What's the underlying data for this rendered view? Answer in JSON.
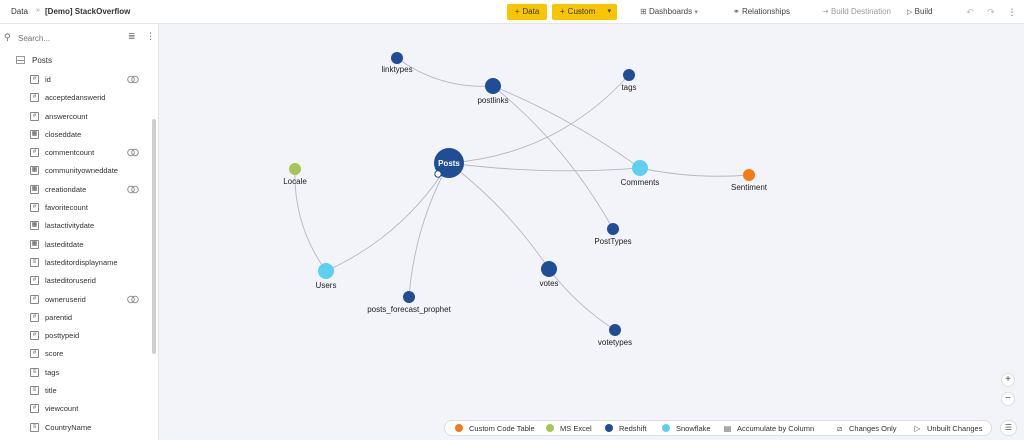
{
  "topbar": {
    "breadcrumb_root": "Data",
    "breadcrumb_sep": "»",
    "project": "[Demo] StackOverflow",
    "data_button": "Data",
    "custom_button": "Custom",
    "dashboards": "Dashboards",
    "relationships": "Relationships",
    "build_destination": "Build Destination",
    "build": "Build",
    "accent_color": "#f7c600"
  },
  "sidebar": {
    "search_placeholder": "Search...",
    "root_table": "Posts",
    "fields": [
      {
        "name": "id",
        "type": "#",
        "linked": true
      },
      {
        "name": "acceptedanswerid",
        "type": "#",
        "linked": false
      },
      {
        "name": "answercount",
        "type": "#",
        "linked": false
      },
      {
        "name": "closeddate",
        "type": "date",
        "linked": false
      },
      {
        "name": "commentcount",
        "type": "#",
        "linked": true
      },
      {
        "name": "communityowneddate",
        "type": "date",
        "linked": false
      },
      {
        "name": "creationdate",
        "type": "date",
        "linked": true
      },
      {
        "name": "favoritecount",
        "type": "#",
        "linked": false
      },
      {
        "name": "lastactivitydate",
        "type": "date",
        "linked": false
      },
      {
        "name": "lasteditdate",
        "type": "date",
        "linked": false
      },
      {
        "name": "lasteditordisplayname",
        "type": "text",
        "linked": false
      },
      {
        "name": "lasteditoruserid",
        "type": "#",
        "linked": false
      },
      {
        "name": "owneruserid",
        "type": "#",
        "linked": true
      },
      {
        "name": "parentid",
        "type": "#",
        "linked": false
      },
      {
        "name": "posttypeid",
        "type": "#",
        "linked": false
      },
      {
        "name": "score",
        "type": "#",
        "linked": false
      },
      {
        "name": "tags",
        "type": "text",
        "linked": false
      },
      {
        "name": "title",
        "type": "text",
        "linked": false
      },
      {
        "name": "viewcount",
        "type": "#",
        "linked": false
      },
      {
        "name": "CountryName",
        "type": "text",
        "linked": false
      }
    ]
  },
  "graph": {
    "colors": {
      "redshift": "#1f4e96",
      "snowflake": "#5bd0f0",
      "msexcel": "#a8c455",
      "custom": "#f47b16",
      "edge": "#b7b7c4"
    },
    "nodes": [
      {
        "id": "Posts",
        "label": "Posts",
        "source": "redshift"
      },
      {
        "id": "linktypes",
        "label": "linktypes",
        "source": "redshift"
      },
      {
        "id": "postlinks",
        "label": "postlinks",
        "source": "redshift"
      },
      {
        "id": "tags",
        "label": "tags",
        "source": "redshift"
      },
      {
        "id": "Locale",
        "label": "Locale",
        "source": "msexcel"
      },
      {
        "id": "Comments",
        "label": "Comments",
        "source": "snowflake"
      },
      {
        "id": "Sentiment",
        "label": "Sentiment",
        "source": "custom"
      },
      {
        "id": "PostTypes",
        "label": "PostTypes",
        "source": "redshift"
      },
      {
        "id": "Users",
        "label": "Users",
        "source": "snowflake"
      },
      {
        "id": "votes",
        "label": "votes",
        "source": "redshift"
      },
      {
        "id": "posts_forecast_prophet",
        "label": "posts_forecast_prophet",
        "source": "redshift"
      },
      {
        "id": "votetypes",
        "label": "votetypes",
        "source": "redshift"
      }
    ],
    "edges": [
      [
        "linktypes",
        "postlinks"
      ],
      [
        "postlinks",
        "Comments"
      ],
      [
        "postlinks",
        "PostTypes"
      ],
      [
        "Posts",
        "tags"
      ],
      [
        "Posts",
        "Comments"
      ],
      [
        "Comments",
        "Sentiment"
      ],
      [
        "Posts",
        "Users"
      ],
      [
        "Locale",
        "Users"
      ],
      [
        "Posts",
        "posts_forecast_prophet"
      ],
      [
        "Posts",
        "votes"
      ],
      [
        "votes",
        "votetypes"
      ]
    ]
  },
  "legend": {
    "custom_code_table": "Custom Code Table",
    "ms_excel": "MS Excel",
    "redshift": "Redshift",
    "snowflake": "Snowflake",
    "accumulate_by_column": "Accumulate by Column",
    "changes_only": "Changes Only",
    "unbuilt_changes": "Unbuilt Changes"
  }
}
